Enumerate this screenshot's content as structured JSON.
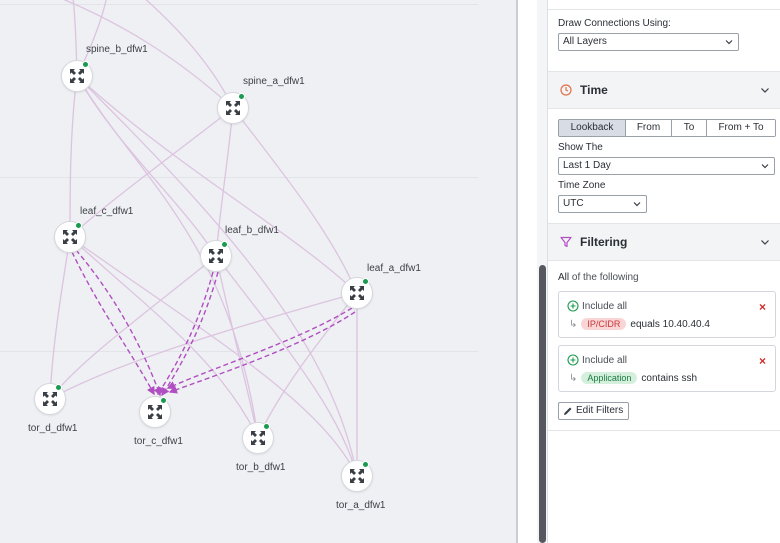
{
  "topology": {
    "nodes": [
      {
        "id": "spine_b",
        "label": "spine_b_dfw1"
      },
      {
        "id": "spine_a",
        "label": "spine_a_dfw1"
      },
      {
        "id": "leaf_c",
        "label": "leaf_c_dfw1"
      },
      {
        "id": "leaf_b",
        "label": "leaf_b_dfw1"
      },
      {
        "id": "leaf_a",
        "label": "leaf_a_dfw1"
      },
      {
        "id": "tor_d",
        "label": "tor_d_dfw1"
      },
      {
        "id": "tor_c",
        "label": "tor_c_dfw1"
      },
      {
        "id": "tor_b",
        "label": "tor_b_dfw1"
      },
      {
        "id": "tor_a",
        "label": "tor_a_dfw1"
      }
    ],
    "colors": {
      "edge": "#dcc4e0",
      "highlight": "#b04fc2",
      "status": "#1a9a4f"
    }
  },
  "panel": {
    "draw": {
      "label": "Draw Connections Using:",
      "value": "All Layers"
    },
    "time": {
      "title": "Time",
      "modes": [
        "Lookback",
        "From",
        "To",
        "From + To"
      ],
      "active_mode": "Lookback",
      "show_label": "Show The",
      "show_value": "Last 1 Day",
      "tz_label": "Time Zone",
      "tz_value": "UTC"
    },
    "filtering": {
      "title": "Filtering",
      "match_prefix": "All",
      "match_suffix": "of the following",
      "rules": [
        {
          "include": "Include all",
          "field": "IP/CIDR",
          "op": "equals",
          "value": "10.40.40.4"
        },
        {
          "include": "Include all",
          "field": "Application",
          "op": "contains",
          "value": "ssh"
        }
      ],
      "edit_label": "Edit Filters"
    }
  }
}
